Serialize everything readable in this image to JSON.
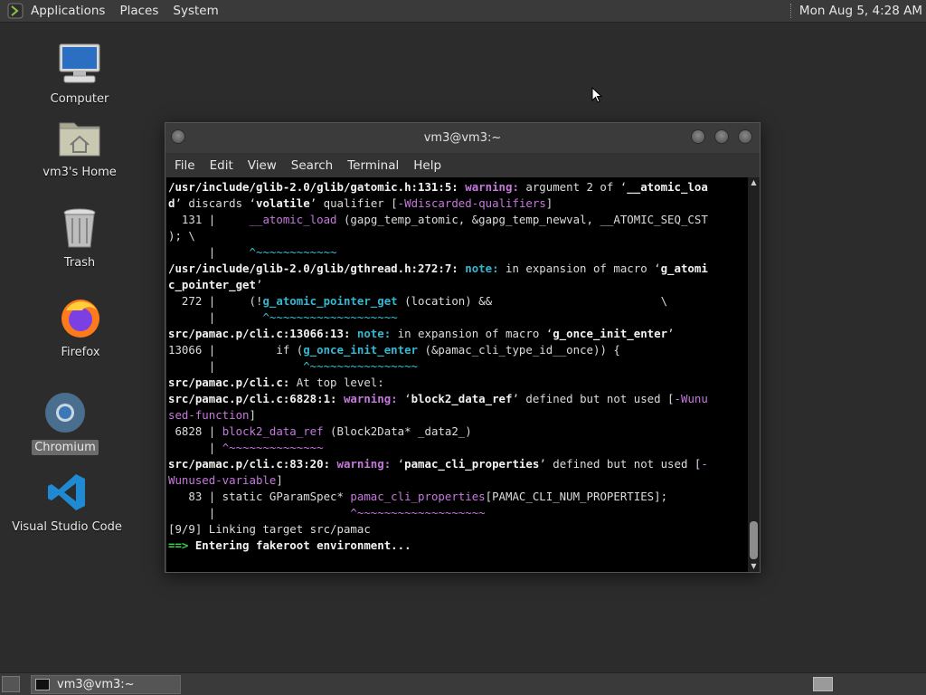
{
  "top_panel": {
    "menu": [
      "Applications",
      "Places",
      "System"
    ],
    "clock": "Mon Aug  5, 4:28 AM"
  },
  "desktop_icons": [
    {
      "label": "Computer",
      "icon": "computer-icon"
    },
    {
      "label": "vm3's Home",
      "icon": "home-folder-icon"
    },
    {
      "label": "Trash",
      "icon": "trash-icon"
    },
    {
      "label": "Firefox",
      "icon": "firefox-icon"
    },
    {
      "label": "Chromium",
      "icon": "chromium-icon"
    },
    {
      "label": "Visual Studio Code",
      "icon": "vscode-icon"
    }
  ],
  "window": {
    "title": "vm3@vm3:~",
    "menu": [
      "File",
      "Edit",
      "View",
      "Search",
      "Terminal",
      "Help"
    ]
  },
  "terminal": {
    "lines": [
      [
        [
          "b",
          "/usr/include/glib-2.0/glib/gatomic.h:131:5: "
        ],
        [
          "w",
          "warning: "
        ],
        [
          "t",
          "argument 2 of ‘"
        ],
        [
          "q",
          "__atomic_loa"
        ]
      ],
      [
        [
          "q",
          "d"
        ],
        [
          "t",
          "’ discards ‘"
        ],
        [
          "q",
          "volatile"
        ],
        [
          "t",
          "’ qualifier ["
        ],
        [
          "m",
          "-Wdiscarded-qualifiers"
        ],
        [
          "t",
          "]"
        ]
      ],
      [
        [
          "t",
          "  131 |     "
        ],
        [
          "m",
          "__atomic_load"
        ],
        [
          "t",
          " (gapg_temp_atomic, &gapg_temp_newval, __ATOMIC_SEQ_CST"
        ]
      ],
      [
        [
          "t",
          "); \\"
        ]
      ],
      [
        [
          "t",
          "      |     "
        ],
        [
          "g",
          "^~~~~~~~~~~~~"
        ]
      ],
      [
        [
          "b",
          "/usr/include/glib-2.0/glib/gthread.h:272:7: "
        ],
        [
          "n",
          "note: "
        ],
        [
          "t",
          "in expansion of macro ‘"
        ],
        [
          "q",
          "g_atomi"
        ]
      ],
      [
        [
          "q",
          "c_pointer_get"
        ],
        [
          "t",
          "’"
        ]
      ],
      [
        [
          "t",
          "  272 |     (!"
        ],
        [
          "n",
          "g_atomic_pointer_get"
        ],
        [
          "t",
          " (location) &&                         \\"
        ]
      ],
      [
        [
          "t",
          "      |       "
        ],
        [
          "g",
          "^~~~~~~~~~~~~~~~~~~~"
        ]
      ],
      [
        [
          "b",
          "src/pamac.p/cli.c:13066:13: "
        ],
        [
          "n",
          "note: "
        ],
        [
          "t",
          "in expansion of macro ‘"
        ],
        [
          "q",
          "g_once_init_enter"
        ],
        [
          "t",
          "’"
        ]
      ],
      [
        [
          "t",
          "13066 |         if ("
        ],
        [
          "n",
          "g_once_init_enter"
        ],
        [
          "t",
          " (&pamac_cli_type_id__once)) {"
        ]
      ],
      [
        [
          "t",
          "      |             "
        ],
        [
          "g",
          "^~~~~~~~~~~~~~~~~"
        ]
      ],
      [
        [
          "b",
          "src/pamac.p/cli.c: "
        ],
        [
          "t",
          "At top level:"
        ]
      ],
      [
        [
          "b",
          "src/pamac.p/cli.c:6828:1: "
        ],
        [
          "w",
          "warning: "
        ],
        [
          "t",
          "‘"
        ],
        [
          "q",
          "block2_data_ref"
        ],
        [
          "t",
          "’ defined but not used ["
        ],
        [
          "m",
          "-Wunu"
        ]
      ],
      [
        [
          "m",
          "sed-function"
        ],
        [
          "t",
          "]"
        ]
      ],
      [
        [
          "t",
          " 6828 | "
        ],
        [
          "m",
          "block2_data_ref"
        ],
        [
          "t",
          " (Block2Data* _data2_)"
        ]
      ],
      [
        [
          "t",
          "      | "
        ],
        [
          "m",
          "^~~~~~~~~~~~~~~"
        ]
      ],
      [
        [
          "b",
          "src/pamac.p/cli.c:83:20: "
        ],
        [
          "w",
          "warning: "
        ],
        [
          "t",
          "‘"
        ],
        [
          "q",
          "pamac_cli_properties"
        ],
        [
          "t",
          "’ defined but not used ["
        ],
        [
          "m",
          "-"
        ]
      ],
      [
        [
          "m",
          "Wunused-variable"
        ],
        [
          "t",
          "]"
        ]
      ],
      [
        [
          "t",
          "   83 | static GParamSpec* "
        ],
        [
          "m",
          "pamac_cli_properties"
        ],
        [
          "t",
          "[PAMAC_CLI_NUM_PROPERTIES];"
        ]
      ],
      [
        [
          "t",
          "      |                    "
        ],
        [
          "m",
          "^~~~~~~~~~~~~~~~~~~~"
        ]
      ],
      [
        [
          "t",
          "[9/9] Linking target src/pamac"
        ]
      ],
      [
        [
          "gr",
          "==> "
        ],
        [
          "q",
          "Entering fakeroot environment..."
        ]
      ]
    ]
  },
  "taskbar": {
    "tasks": [
      "vm3@vm3:~"
    ]
  }
}
